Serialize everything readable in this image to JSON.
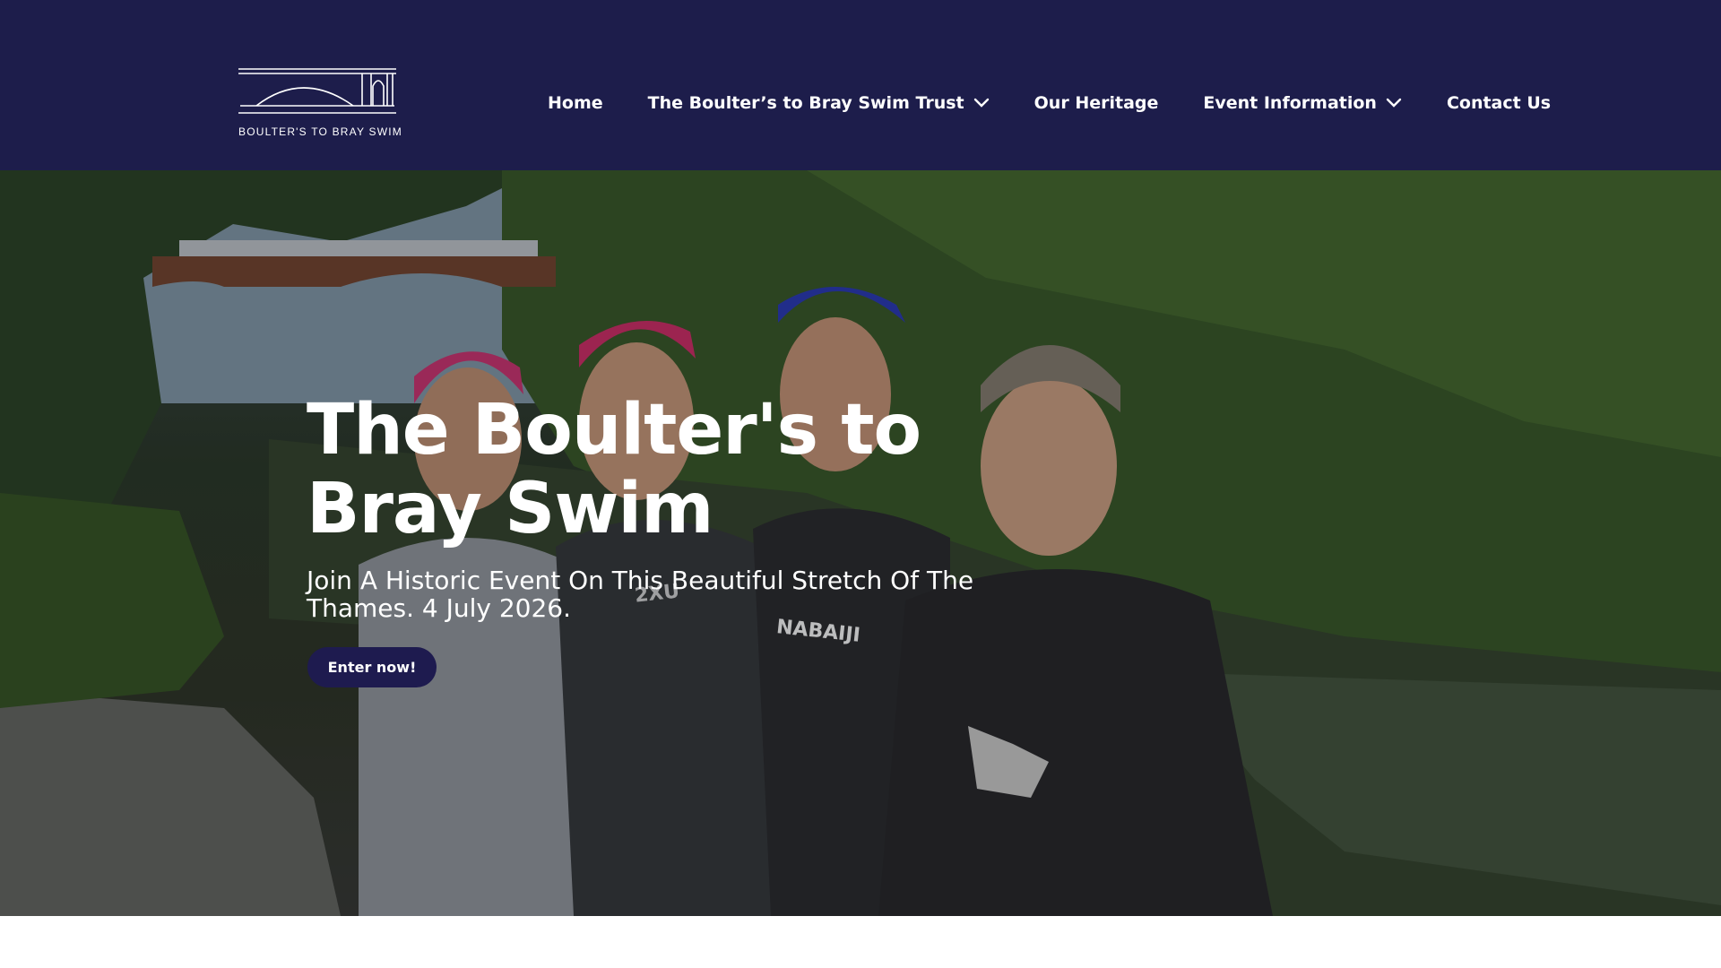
{
  "brand": {
    "logo_text": "BOULTER'S TO BRAY SWIM"
  },
  "nav": {
    "items": [
      {
        "label": "Home",
        "has_dropdown": false
      },
      {
        "label": "The Boulter’s to Bray Swim Trust",
        "has_dropdown": true
      },
      {
        "label": "Our Heritage",
        "has_dropdown": false
      },
      {
        "label": "Event Information",
        "has_dropdown": true
      },
      {
        "label": "Contact Us",
        "has_dropdown": false
      }
    ]
  },
  "hero": {
    "title_line1": "The Boulter's to",
    "title_line2": "Bray Swim",
    "subtitle_line1": "Join A Historic Event On This Beautiful Stretch Of The",
    "subtitle_line2": "Thames. 4 July 2026.",
    "cta_label": "Enter now!",
    "wetsuit_texts": [
      "2XU",
      "NABAIJI"
    ]
  },
  "colors": {
    "header_bg": "#1d1d4b",
    "cta_bg": "#1e1b4f",
    "text_on_dark": "#ffffff"
  }
}
